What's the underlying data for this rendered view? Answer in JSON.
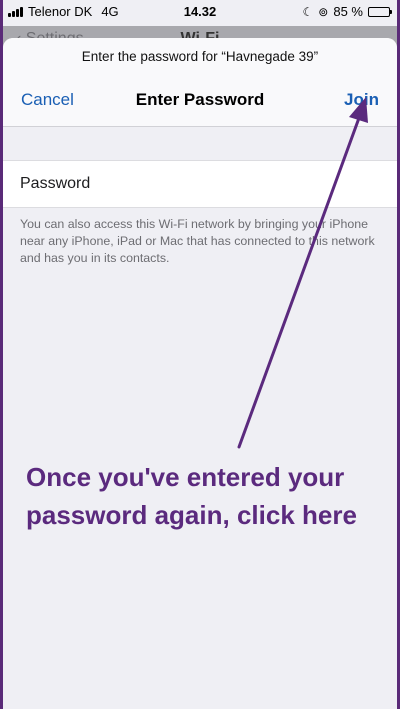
{
  "status_bar": {
    "carrier": "Telenor DK",
    "network": "4G",
    "time": "14.32",
    "battery": "85 %",
    "battery_level": 0.85
  },
  "background_nav": {
    "back_label": "Settings",
    "title": "Wi-Fi"
  },
  "sheet": {
    "prompt": "Enter the password for “Havnegade 39”",
    "cancel_label": "Cancel",
    "title": "Enter Password",
    "join_label": "Join",
    "password_placeholder": "Password",
    "note": "You can also access this Wi-Fi network by bringing your iPhone near any iPhone, iPad or Mac that has connected to this network and has you in its contacts."
  },
  "annotation": {
    "text": "Once you've entered your password again, click here",
    "color": "#5b2a7e"
  },
  "colors": {
    "link": "#1a5fb4",
    "frame": "#5a2a78"
  }
}
